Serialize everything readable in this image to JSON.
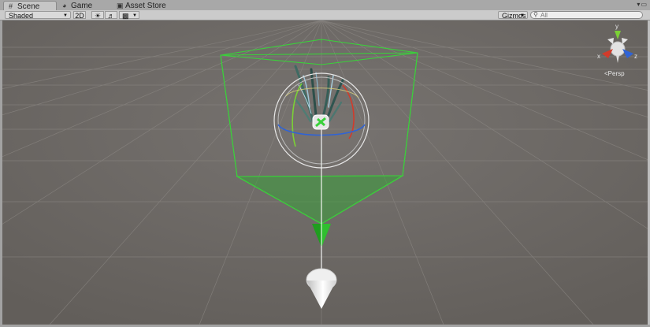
{
  "tabs": [
    {
      "label": "Scene",
      "icon": "grid-icon",
      "active": true
    },
    {
      "label": "Game",
      "icon": "pacman-icon",
      "active": false
    },
    {
      "label": "Asset Store",
      "icon": "store-icon",
      "active": false
    }
  ],
  "toolbar": {
    "shading_mode": "Shaded",
    "mode_2d_label": "2D",
    "lighting_icon": "sun-icon",
    "audio_icon": "speaker-icon",
    "effects_icon": "image-icon",
    "gizmos_label": "Gizmos",
    "search_placeholder": "All"
  },
  "scene": {
    "camera_label": "Persp",
    "axis_labels": {
      "y": "y",
      "x": "x",
      "z": "z"
    }
  },
  "colors": {
    "viewport_bg": "#6e6a66",
    "bounds_green": "#3ad13a",
    "axis_x": "#d23b2b",
    "axis_y": "#7bd136",
    "axis_z": "#2f63d6"
  }
}
